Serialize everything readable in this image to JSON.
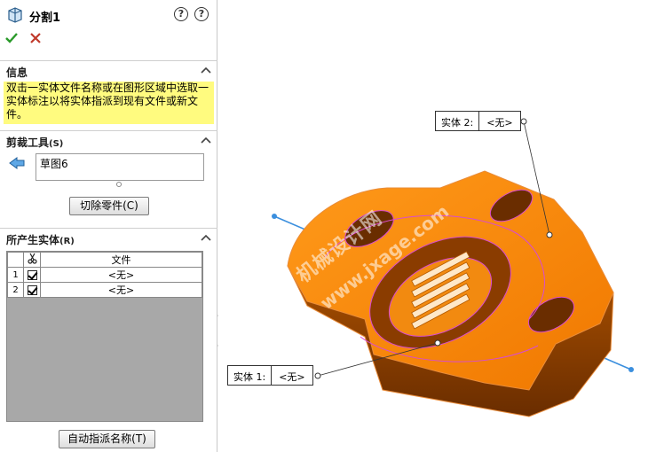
{
  "panel": {
    "title": "分割1",
    "help_label": "?",
    "help2_label": "?"
  },
  "info": {
    "header": "信息",
    "text": "双击一实体文件名称或在图形区域中选取一实体标注以将实体指派到现有文件或新文件。"
  },
  "trim_tools": {
    "header": "剪裁工具",
    "header_key": "(S)",
    "selection": "草图6",
    "cut_button": "切除零件(C)"
  },
  "resulting_bodies": {
    "header": "所产生实体",
    "header_key": "(R)",
    "column_file": "文件",
    "rows": [
      {
        "num": "1",
        "checked": true,
        "file": "<无>"
      },
      {
        "num": "2",
        "checked": true,
        "file": "<无>"
      }
    ],
    "auto_assign_button": "自动指派名称(T)"
  },
  "viewport": {
    "callout_top": {
      "label": "实体  2:",
      "value": "<无>"
    },
    "callout_bottom": {
      "label": "实体  1:",
      "value": "<无>"
    },
    "watermark_cn": "机械设计网",
    "watermark_url": "www.jxage.com"
  },
  "colors": {
    "accent_ok": "#2a9a2a",
    "cancel": "#c0392b",
    "info_bg": "#fffb7f",
    "model_orange": "#ff8a00",
    "model_dark": "#7a3500",
    "edge_pink": "#d94bd0",
    "axis_blue": "#3b8fde"
  },
  "icons": {
    "tool": "split-feature-icon",
    "ok": "checkmark-icon",
    "cancel": "x-icon",
    "collapse": "chevron-up-icon",
    "sketch": "sketch-arrow-icon",
    "scissors": "scissors-icon"
  }
}
